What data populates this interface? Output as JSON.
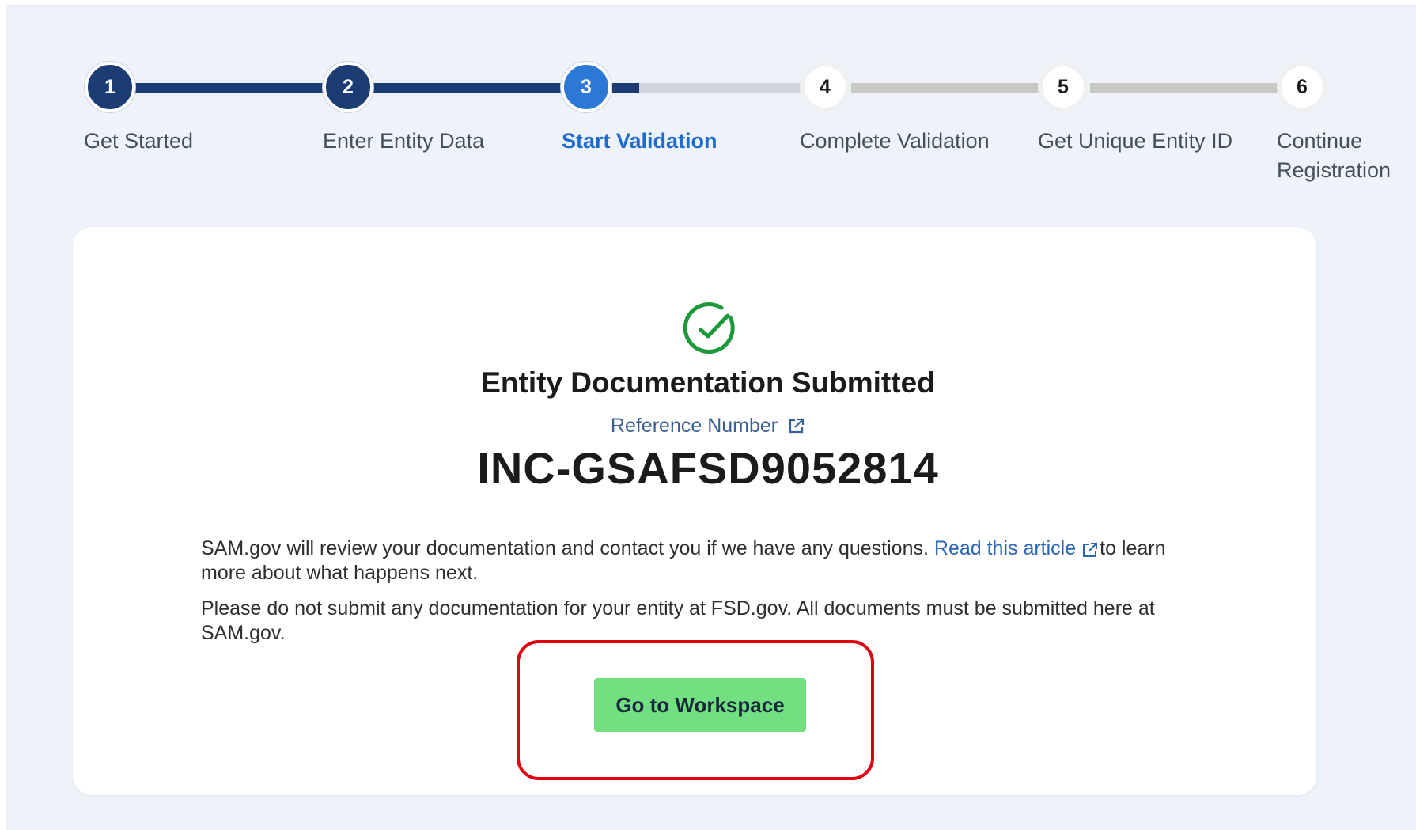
{
  "stepper": {
    "steps": [
      {
        "number": "1",
        "label": "Get Started",
        "state": "completed"
      },
      {
        "number": "2",
        "label": "Enter Entity Data",
        "state": "completed"
      },
      {
        "number": "3",
        "label": "Start Validation",
        "state": "current"
      },
      {
        "number": "4",
        "label": "Complete Validation",
        "state": "upcoming"
      },
      {
        "number": "5",
        "label": "Get Unique Entity ID",
        "state": "upcoming"
      },
      {
        "number": "6",
        "label": "Continue Registration",
        "state": "upcoming",
        "label_lines": [
          "Continue",
          "Registration"
        ]
      }
    ]
  },
  "card": {
    "status_icon": "check-circle-icon",
    "title": "Entity Documentation Submitted",
    "reference_label": "Reference Number",
    "reference_number": "INC-GSAFSD9052814",
    "message_prefix": "SAM.gov will review your documentation and contact you if we have any questions. ",
    "message_link": "Read this article",
    "message_suffix": "to learn more about what happens next.",
    "notice": "Please do not submit any documentation for your entity at FSD.gov. All documents must be submitted here at SAM.gov.",
    "button_label": "Go to Workspace"
  },
  "colors": {
    "completed_step": "#1b3d73",
    "current_step": "#2b78d6",
    "upcoming_line": "#c8c8c5",
    "success_green": "#1a9a3a",
    "button_green": "#72df80",
    "highlight_red": "#e1000f",
    "link_blue": "#2b65b8"
  }
}
